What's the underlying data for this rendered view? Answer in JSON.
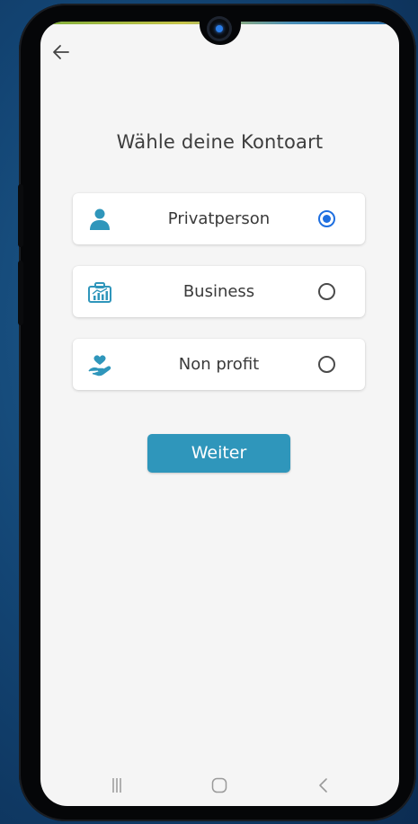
{
  "screen": {
    "title": "Wähle deine Kontoart",
    "icons": {
      "back": "arrow-left-icon"
    },
    "colors": {
      "accent": "#2f96bb",
      "radio_selected": "#1e6fe0",
      "background": "#f5f5f5"
    }
  },
  "options": [
    {
      "label": "Privatperson",
      "icon": "person-icon",
      "selected": true
    },
    {
      "label": "Business",
      "icon": "briefcase-chart-icon",
      "selected": false
    },
    {
      "label": "Non profit",
      "icon": "heart-hand-icon",
      "selected": false
    }
  ],
  "continue_button": {
    "label": "Weiter"
  },
  "system_nav": {
    "recents": "recents-icon",
    "home": "home-icon",
    "back": "back-chevron-icon"
  }
}
